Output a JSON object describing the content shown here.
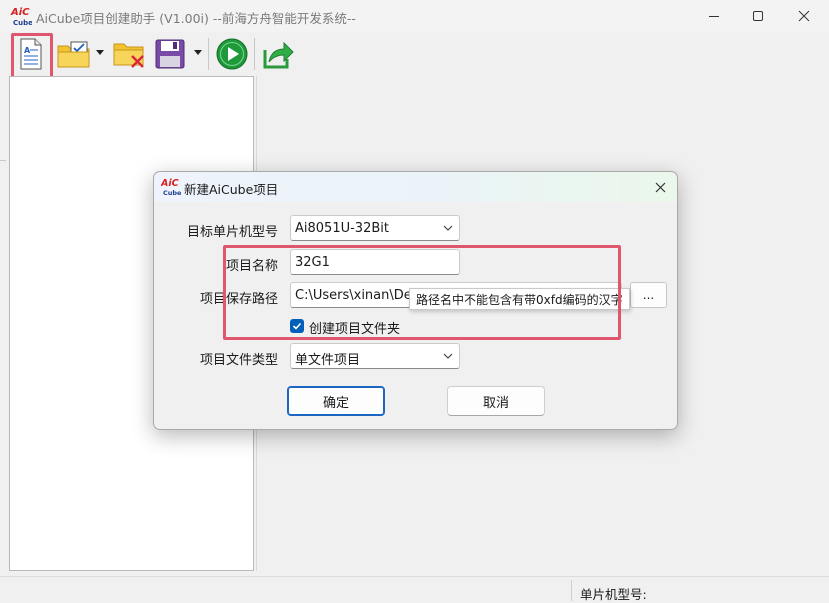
{
  "window": {
    "logo_text_top": "AiC",
    "logo_text_bottom": "Cube",
    "title": "AiCube项目创建助手 (V1.00i) --前海方舟智能开发系统--"
  },
  "toolbar": {
    "items": [
      "new-project",
      "open-project",
      "close-project",
      "save-project",
      "run",
      "export"
    ]
  },
  "statusbar": {
    "mcu_label": "单片机型号:"
  },
  "dialog": {
    "title": "新建AiCube项目",
    "mcu_label": "目标单片机型号",
    "mcu_value": "Ai8051U-32Bit",
    "name_label": "项目名称",
    "name_value": "32G1",
    "path_label": "项目保存路径",
    "path_value": "C:\\Users\\xinan\\Desktop\\Aicube\\1\\1",
    "browse_label": "...",
    "create_folder_label": "创建项目文件夹",
    "create_folder_checked": true,
    "type_label": "项目文件类型",
    "type_value": "单文件项目",
    "ok_label": "确定",
    "cancel_label": "取消",
    "tooltip": "路径名中不能包含有带0xfd编码的汉字"
  },
  "colors": {
    "highlight": "#e0566f",
    "accent": "#005fb8",
    "run_green": "#1e9a3a",
    "folder_yellow": "#f2c230"
  }
}
